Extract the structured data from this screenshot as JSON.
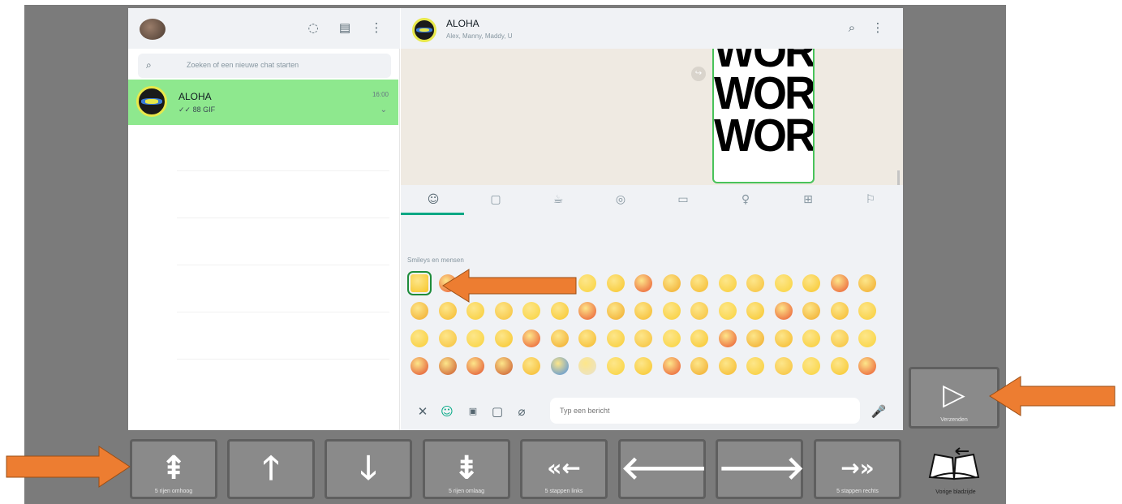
{
  "left_panel": {
    "search_placeholder": "Zoeken of een nieuwe chat starten",
    "chat": {
      "name": "ALOHA",
      "preview": "✓✓ 88 GIF",
      "time": "16:00"
    }
  },
  "right_panel": {
    "group_name": "ALOHA",
    "group_members": "Alex, Manny, Maddy, U",
    "sticker_words": [
      "WORK",
      "WORK",
      "WORK"
    ],
    "emoji_category": "Smileys en mensen",
    "message_placeholder": "Typ een bericht"
  },
  "icons": {
    "header_left": [
      "status-icon",
      "new-chat-icon",
      "menu-icon"
    ],
    "header_right": [
      "search-icon",
      "menu-icon"
    ],
    "emoji_tabs": [
      "smiley-icon",
      "animal-icon",
      "food-icon",
      "activity-icon",
      "travel-icon",
      "object-icon",
      "symbol-icon",
      "flag-icon"
    ],
    "compose": [
      "close-icon",
      "emoji-icon",
      "gif-icon",
      "sticker-icon",
      "attach-icon",
      "mic-icon"
    ]
  },
  "keyboard": {
    "buttons": [
      {
        "id": "five-rows-up",
        "glyph": "⇞",
        "label": "5 rijen omhoog"
      },
      {
        "id": "up",
        "glyph": "🡑",
        "label": ""
      },
      {
        "id": "down",
        "glyph": "🡓",
        "label": ""
      },
      {
        "id": "five-rows-down",
        "glyph": "⇟",
        "label": "5 rijen omlaag"
      },
      {
        "id": "five-left",
        "glyph": "«←",
        "label": "5 stappen links"
      },
      {
        "id": "left",
        "glyph": "🡐",
        "label": ""
      },
      {
        "id": "right",
        "glyph": "🡒",
        "label": ""
      },
      {
        "id": "five-right",
        "glyph": "→»",
        "label": "5 stappen rechts"
      }
    ],
    "send": {
      "glyph": "▷",
      "label": "Verzenden"
    },
    "previous_page_label": "Vorige bladzijde"
  },
  "colors": {
    "chat_highlight": "#8ee88e",
    "accent": "#00a884",
    "callout_arrow": "#ed7d31",
    "keypad_bg": "#8a8a8a"
  }
}
